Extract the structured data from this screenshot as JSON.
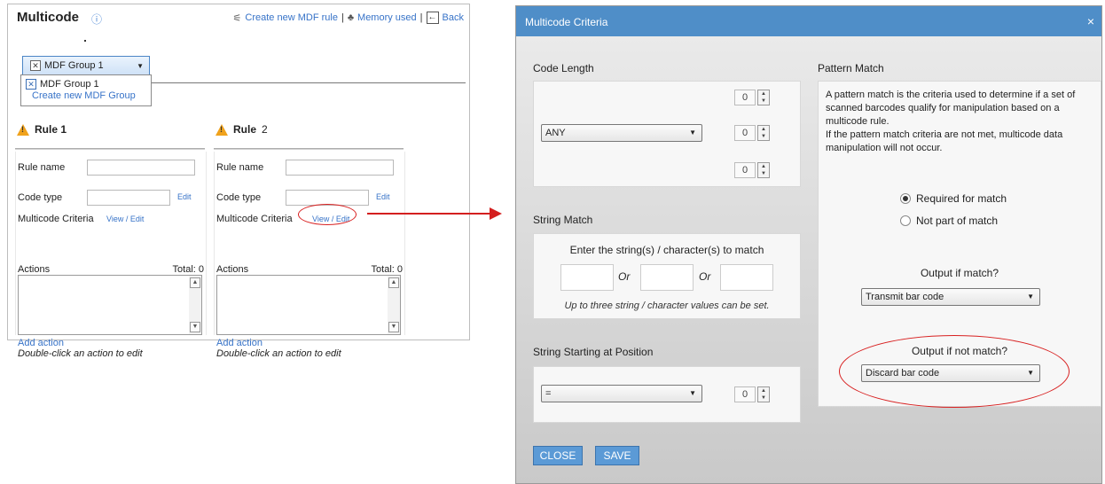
{
  "left": {
    "title": "Multicode",
    "info_icon": "ⓘ",
    "links": {
      "create_rule": "Create new MDF rule",
      "memory": "Memory used",
      "back": "Back"
    },
    "group_select": "MDF Group 1",
    "group_options": [
      "MDF Group 1"
    ],
    "create_group": "Create new MDF Group",
    "rules": [
      {
        "title": "Rule 1",
        "number_suffix": "",
        "rule_name_label": "Rule name",
        "code_type_label": "Code type",
        "edit": "Edit",
        "criteria_label": "Multicode Criteria",
        "view_edit": "View / Edit",
        "actions_label": "Actions",
        "total": "Total: 0",
        "add_action": "Add action",
        "hint": "Double-click an action to edit"
      },
      {
        "title": "Rule",
        "number_suffix": "2",
        "rule_name_label": "Rule name",
        "code_type_label": "Code type",
        "edit": "Edit",
        "criteria_label": "Multicode Criteria",
        "view_edit": "View / Edit",
        "actions_label": "Actions",
        "total": "Total: 0",
        "add_action": "Add action",
        "hint": "Double-click an action to edit"
      }
    ]
  },
  "dialog": {
    "title": "Multicode Criteria",
    "close_x": "×",
    "code_length": {
      "label": "Code Length",
      "select": "ANY",
      "spin_values": [
        "0",
        "0",
        "0"
      ]
    },
    "string_match": {
      "label": "String Match",
      "instruction": "Enter the string(s) / character(s) to match",
      "or": "Or",
      "note": "Up to three string / character values can be set."
    },
    "string_start": {
      "label": "String Starting at Position",
      "select": "=",
      "spin_value": "0"
    },
    "pattern_match": {
      "label": "Pattern Match",
      "description": "A pattern match is the criteria used to determine if a set of scanned barcodes qualify for manipulation based on a multicode rule.\nIf the pattern match criteria are not met, multicode data manipulation will not occur.",
      "radio_required": "Required for match",
      "radio_not_part": "Not part of match",
      "output_match_label": "Output if match?",
      "output_match_value": "Transmit bar code",
      "output_nomatch_label": "Output if not match?",
      "output_nomatch_value": "Discard bar code"
    },
    "buttons": {
      "close": "CLOSE",
      "save": "SAVE"
    }
  }
}
